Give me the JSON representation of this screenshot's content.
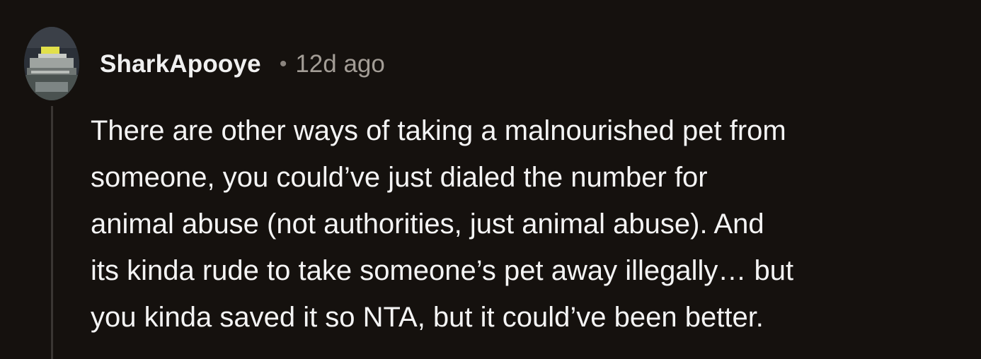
{
  "comment": {
    "author": "SharkApooye",
    "separator": "•",
    "time_ago": "12d ago",
    "body_lines": [
      "There are other ways of taking a malnourished pet from",
      "someone, you could’ve just dialed the number for",
      "animal abuse (not authorities, just animal abuse). And",
      "its kinda rude to take someone’s pet away illegally… but",
      "you kinda saved it so NTA, but it could’ve been better."
    ]
  },
  "colors": {
    "background": "#15110e",
    "username": "#f0f0f0",
    "timestamp": "#a39d96",
    "body": "#f4f4f4",
    "thread_line": "#3a3633"
  },
  "icons": {
    "avatar": "user-avatar-image"
  }
}
